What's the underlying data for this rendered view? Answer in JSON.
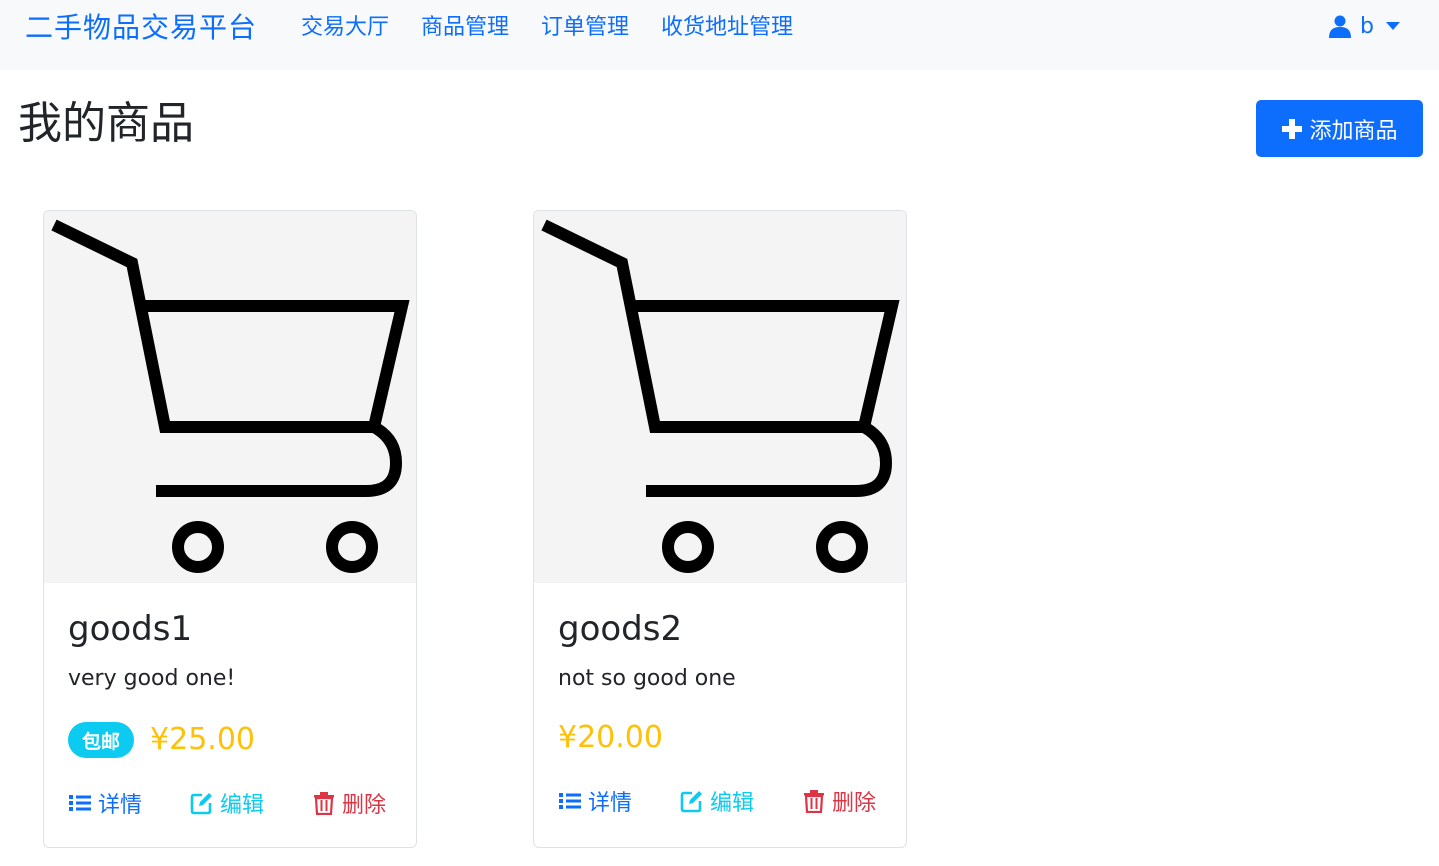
{
  "navbar": {
    "brand": "二手物品交易平台",
    "links": [
      "交易大厅",
      "商品管理",
      "订单管理",
      "收货地址管理"
    ],
    "user": "b"
  },
  "page": {
    "title": "我的商品",
    "add_button": "添加商品"
  },
  "goods": [
    {
      "name": "goods1",
      "description": "very good one!",
      "badge": "包邮",
      "price": "¥25.00",
      "actions": {
        "detail": "详情",
        "edit": "编辑",
        "delete": "删除"
      },
      "image_icon": "shopping-cart-icon"
    },
    {
      "name": "goods2",
      "description": "not so good one",
      "badge": "",
      "price": "¥20.00",
      "actions": {
        "detail": "详情",
        "edit": "编辑",
        "delete": "删除"
      },
      "image_icon": "shopping-cart-icon"
    }
  ],
  "colors": {
    "primary": "#0d6efd",
    "info": "#0dcaf0",
    "warning": "#ffc107",
    "danger": "#dc3545"
  }
}
